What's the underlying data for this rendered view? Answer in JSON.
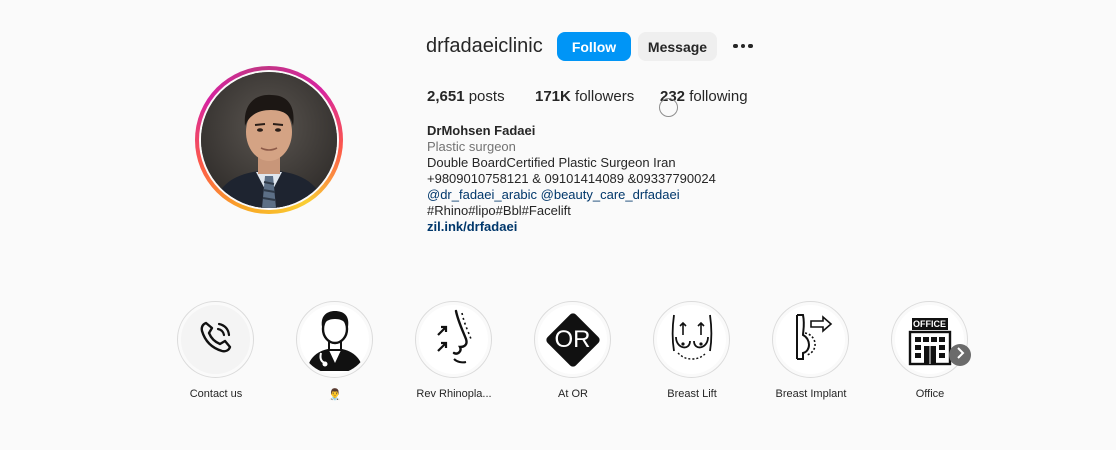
{
  "profile": {
    "username": "drfadaeiclinic",
    "follow_label": "Follow",
    "message_label": "Message",
    "more_icon": "more-options-icon",
    "stats": {
      "posts_count": "2,651",
      "posts_label": "posts",
      "followers_count": "171K",
      "followers_label": "followers",
      "following_count": "232",
      "following_label": "following"
    },
    "bio": {
      "name": "DrMohsen Fadaei",
      "category": "Plastic surgeon",
      "line1": "Double BoardCertified Plastic Surgeon Iran",
      "line2": "+9809010758121 & 09101414089 &09337790024",
      "mentions": "@dr_fadaei_arabic @beauty_care_drfadaei",
      "hashtags": "#Rhino#lipo#Bbl#Facelift",
      "link": "zil.ink/drfadaei"
    }
  },
  "highlights": [
    {
      "label": "Contact us",
      "icon": "phone-icon"
    },
    {
      "label": "👨‍⚕️",
      "icon": "doctor-icon"
    },
    {
      "label": "Rev Rhinopla...",
      "icon": "nose-profile-icon"
    },
    {
      "label": "At OR",
      "icon": "or-sign-icon"
    },
    {
      "label": "Breast Lift",
      "icon": "breast-lift-icon"
    },
    {
      "label": "Breast Implant",
      "icon": "breast-implant-icon"
    },
    {
      "label": "Office",
      "icon": "office-building-icon"
    }
  ],
  "highlight_office_sign": "OFFICE",
  "highlight_or_sign": "OR",
  "colors": {
    "follow_blue": "#0095f6",
    "link_blue": "#00376b",
    "background": "#fafafa"
  }
}
